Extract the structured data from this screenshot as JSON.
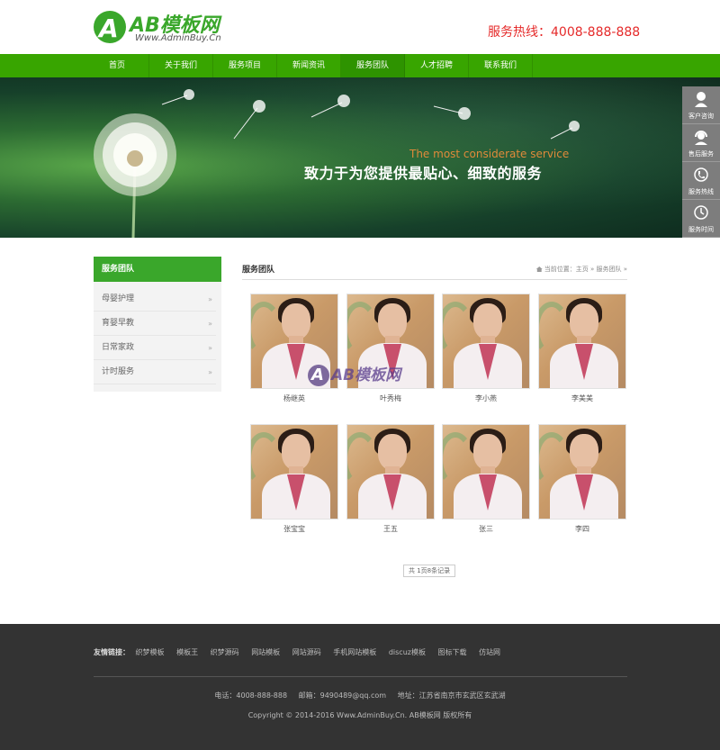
{
  "header": {
    "logo_mark": "A",
    "logo_name": "AB模板网",
    "logo_url": "Www.AdminBuy.Cn",
    "hotline": "服务热线：4008-888-888"
  },
  "nav": {
    "items": [
      "首页",
      "关于我们",
      "服务项目",
      "新闻资讯",
      "服务团队",
      "人才招聘",
      "联系我们"
    ],
    "active_index": 4
  },
  "banner": {
    "tagline_en": "The most considerate service",
    "tagline_cn": "致力于为您提供最贴心、细致的服务"
  },
  "float_bar": {
    "items": [
      {
        "icon": "user-icon",
        "label": "客户咨询"
      },
      {
        "icon": "headset-icon",
        "label": "售后服务"
      },
      {
        "icon": "phone-icon",
        "label": "服务热线"
      },
      {
        "icon": "clock-icon",
        "label": "服务时间"
      }
    ]
  },
  "left": {
    "title": "服务团队",
    "items": [
      "母婴护理",
      "育婴早教",
      "日常家政",
      "计时服务"
    ]
  },
  "main": {
    "title": "服务团队",
    "breadcrumb": "当前位置：主页 » 服务团队 »",
    "members": [
      "杨继英",
      "叶秀梅",
      "李小燕",
      "李美美",
      "张宝宝",
      "王五",
      "张三",
      "李四"
    ],
    "pager": "共 1页8条记录"
  },
  "watermark": {
    "mark": "A",
    "text": "AB模板网"
  },
  "footer": {
    "links_label": "友情链接：",
    "links": [
      "织梦模板",
      "模板王",
      "织梦源码",
      "网站模板",
      "网站源码",
      "手机网站模板",
      "discuz模板",
      "图标下载",
      "仿站网"
    ],
    "phone": "电话：4008-888-888",
    "email": "邮箱：9490489@qq.com",
    "address": "地址：江苏省南京市玄武区玄武湖",
    "copyright": "Copyright © 2014-2016 Www.AdminBuy.Cn. AB模板网 版权所有"
  },
  "colors": {
    "brand_green": "#38a500",
    "hotline_red": "#e52a2a",
    "footer_bg": "#333333"
  }
}
